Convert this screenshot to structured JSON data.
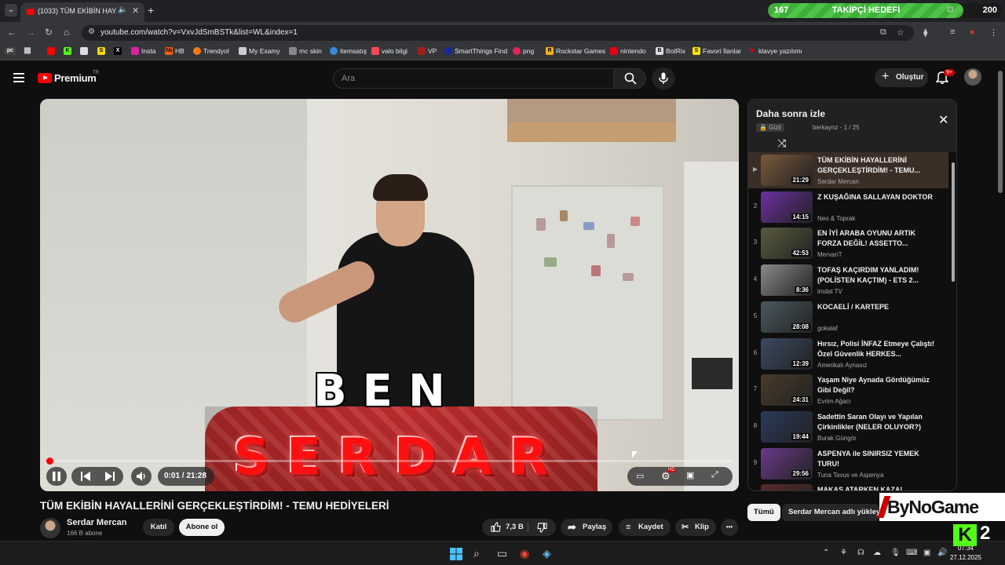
{
  "browser": {
    "tab_title": "(1033) TÜM EKİBİN HAYALL",
    "url": "youtube.com/watch?v=VxvJdSmBSTk&list=WL&index=1",
    "new_tab": "+",
    "bookmarks": [
      "Insta",
      "HB",
      "Trendyol",
      "My Examy",
      "mc skin",
      "itemsatış",
      "valo bilgi",
      "VP",
      "SmartThings Find",
      "png",
      "Rockstar Games",
      "nintendo",
      "BotRix",
      "Favori İlanlar",
      "klavye yazılımı"
    ]
  },
  "follower_goal": {
    "current": "167",
    "label": "TAKİPÇİ HEDEFİ",
    "target": "200",
    "progress_fraction": 0.835
  },
  "header": {
    "brand": "Premium",
    "country": "TR",
    "search_placeholder": "Ara",
    "create_label": "Oluştur",
    "notification_badge": "9+"
  },
  "video": {
    "overlay_top": "BEN",
    "overlay_bottom": "SERDAR",
    "time": "0:01 / 21:28",
    "played_fraction": 0.005,
    "title": "TÜM EKİBİN HAYALLERİNİ GERÇEKLEŞTİRDİM! - TEMU HEDİYELERİ",
    "channel": "Serdar Mercan",
    "subscribers": "166 B abone",
    "join_label": "Katıl",
    "subscribe_label": "Abone ol",
    "likes": "7,3 B",
    "share_label": "Paylaş",
    "save_label": "Kaydet",
    "clip_label": "Klip",
    "more_label": "•••"
  },
  "playlist": {
    "title": "Daha sonra izle",
    "privacy": "Gizli",
    "meta": "berkaynz - 1 / 25",
    "items": [
      {
        "idx": "▶",
        "title": "TÜM EKİBİN HAYALLERİNİ GERÇEKLEŞTİRDİM! - TEMU...",
        "channel": "Serdar Mercan",
        "duration": "21:29",
        "color": "#7a5a3c"
      },
      {
        "idx": "2",
        "title": "Z KUŞAĞINA SALLAYAN DOKTOR",
        "channel": "Neo & Toprak",
        "duration": "14:15",
        "color": "#6b2fa0"
      },
      {
        "idx": "3",
        "title": "EN İYİ ARABA OYUNU ARTIK FORZA DEĞİL! ASSETTO...",
        "channel": "MervanT",
        "duration": "42:53",
        "color": "#5a5a40"
      },
      {
        "idx": "4",
        "title": "TOFAŞ KAÇIRDIM YANLADIM! (POLİSTEN KAÇTIM) - ETS 2...",
        "channel": "imdat TV",
        "duration": "8:36",
        "color": "#8a8a8a"
      },
      {
        "idx": "5",
        "title": "KOCAELİ / KARTEPE",
        "channel": "gokalaf",
        "duration": "28:08",
        "color": "#4a5a60"
      },
      {
        "idx": "6",
        "title": "Hırsız, Polisi İNFAZ Etmeye Çalıştı! Özel Güvenlik HERKES...",
        "channel": "Amerikalı Aynasız",
        "duration": "12:39",
        "color": "#3a4a60"
      },
      {
        "idx": "7",
        "title": "Yaşam Niye Aynada Gördüğümüz Gibi Değil?",
        "channel": "Evrim Ağacı",
        "duration": "24:31",
        "color": "#4a3a2a"
      },
      {
        "idx": "8",
        "title": "Sadettin Saran Olayı ve Yapılan Çirkinlikler (NELER OLUYOR?)",
        "channel": "Burak Güngör",
        "duration": "19:44",
        "color": "#2a3a5a"
      },
      {
        "idx": "9",
        "title": "ASPENYA ile SINIRSIZ YEMEK TURU!",
        "channel": "Tuna Tavus ve Aspenya",
        "duration": "29:56",
        "color": "#6a3a8a"
      },
      {
        "idx": "10",
        "title": "MAKAS ATARKEN KAZA!",
        "channel": "",
        "duration": "",
        "color": "#5a2a2a"
      }
    ]
  },
  "chips": {
    "all": "Tümü",
    "channel": "Serdar Mercan adlı yükleyic"
  },
  "overlay_brand": "ByNoGame",
  "kick": {
    "letter": "K",
    "count": "2"
  },
  "taskbar": {
    "time": "07:34",
    "date": "27.12.2025"
  }
}
